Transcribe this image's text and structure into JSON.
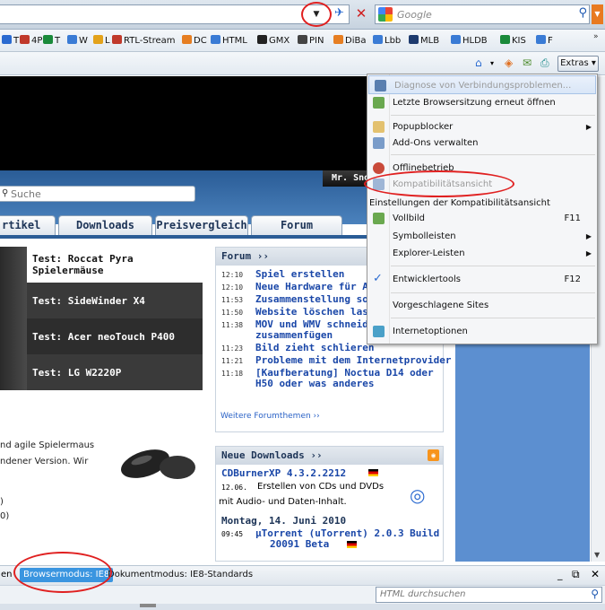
{
  "search": {
    "placeholder": "Google"
  },
  "favorites": [
    {
      "label": "T",
      "color": "#2a6ad0"
    },
    {
      "label": "4P",
      "color": "#c0392b"
    },
    {
      "label": "T",
      "color": "#1a8a3a"
    },
    {
      "label": "W",
      "color": "#3a7bd5"
    },
    {
      "label": "L",
      "color": "#e3a21a"
    },
    {
      "label": "RTL-Stream",
      "color": "#c0392b"
    },
    {
      "label": "DC",
      "color": "#e67e22"
    },
    {
      "label": "HTML",
      "color": "#3a7bd5"
    },
    {
      "label": "GMX",
      "color": "#222222"
    },
    {
      "label": "PIN",
      "color": "#444444"
    },
    {
      "label": "DiBa",
      "color": "#e67e22"
    },
    {
      "label": "Lbb",
      "color": "#3a7bd5"
    },
    {
      "label": "MLB",
      "color": "#1d3a6e"
    },
    {
      "label": "HLDB",
      "color": "#3a7bd5"
    },
    {
      "label": "KIS",
      "color": "#1a8a3a"
    },
    {
      "label": "F",
      "color": "#3a7bd5"
    }
  ],
  "commandbar": {
    "extras": "Extras ▾"
  },
  "site": {
    "search_placeholder": "Suche",
    "login": "Mr. Sno",
    "tabs": [
      "rtikel",
      "Downloads",
      "Preisvergleich",
      "Forum"
    ],
    "teasers": [
      "Test: Roccat Pyra Spielermäuse",
      "Test: SideWinder X4",
      "Test: Acer neoTouch P400",
      "Test: LG W2220P"
    ],
    "forum": {
      "title": "Forum ››",
      "more": "Weitere Forumthemen ››",
      "rows": [
        {
          "time": "12:10",
          "title": "Spiel erstellen"
        },
        {
          "time": "12:10",
          "title": "Neue Hardware für Al"
        },
        {
          "time": "11:53",
          "title": "Zusammenstellung so"
        },
        {
          "time": "11:50",
          "title": "Website löschen lasse"
        },
        {
          "time": "11:38",
          "title": "MOV und WMV schneid",
          "title2": "zusammenfügen"
        },
        {
          "time": "11:23",
          "title": "Bild zieht schlieren"
        },
        {
          "time": "11:21",
          "title": "Probleme mit dem Internetprovider"
        },
        {
          "time": "11:18",
          "title": "[Kaufberatung] Noctua D14 oder",
          "title2": "H50 oder was anderes"
        }
      ]
    },
    "article": {
      "line1": "nd agile Spielermaus",
      "line2": "ndener Version. Wir",
      "note1": ")",
      "note2": "0)"
    },
    "downloads": {
      "title": "Neue Downloads ››",
      "item1": "CDBurnerXP 4.3.2.2212",
      "date1": "12.06.",
      "desc1": "Erstellen von CDs und DVDs",
      "desc1b": "mit Audio- und Daten-Inhalt.",
      "day": "Montag, 14. Juni 2010",
      "time2": "09:45",
      "item2": "µTorrent (uTorrent) 2.0.3 Build",
      "item2b": "20091 Beta"
    }
  },
  "menu": {
    "items": [
      {
        "label": "Diagnose von Verbindungsproblemen...",
        "disabled": true,
        "icon": "diagnose-icon"
      },
      {
        "label": "Letzte Browsersitzung erneut öffnen",
        "icon": "restore-session-icon"
      },
      {
        "label": "Popupblocker",
        "submenu": true,
        "icon": "popup-blocker-icon"
      },
      {
        "label": "Add-Ons verwalten",
        "icon": "addons-icon"
      },
      {
        "label": "Offlinebetrieb",
        "icon": "offline-icon"
      },
      {
        "label": "Kompatibilitätsansicht",
        "disabled": true,
        "icon": "compat-view-icon"
      },
      {
        "label": "Einstellungen der Kompatibilitätsansicht"
      },
      {
        "label": "Vollbild",
        "shortcut": "F11",
        "icon": "fullscreen-icon"
      },
      {
        "label": "Symbolleisten",
        "submenu": true
      },
      {
        "label": "Explorer-Leisten",
        "submenu": true
      },
      {
        "label": "Entwicklertools",
        "shortcut": "F12",
        "checked": true
      },
      {
        "label": "Vorgeschlagene Sites"
      },
      {
        "label": "Internetoptionen",
        "icon": "internet-options-icon"
      }
    ]
  },
  "status": {
    "left": "en",
    "mode": "Browsermodus: IE8",
    "doc": "Dokumentmodus: IE8-Standards"
  },
  "find": {
    "placeholder": "HTML durchsuchen"
  }
}
